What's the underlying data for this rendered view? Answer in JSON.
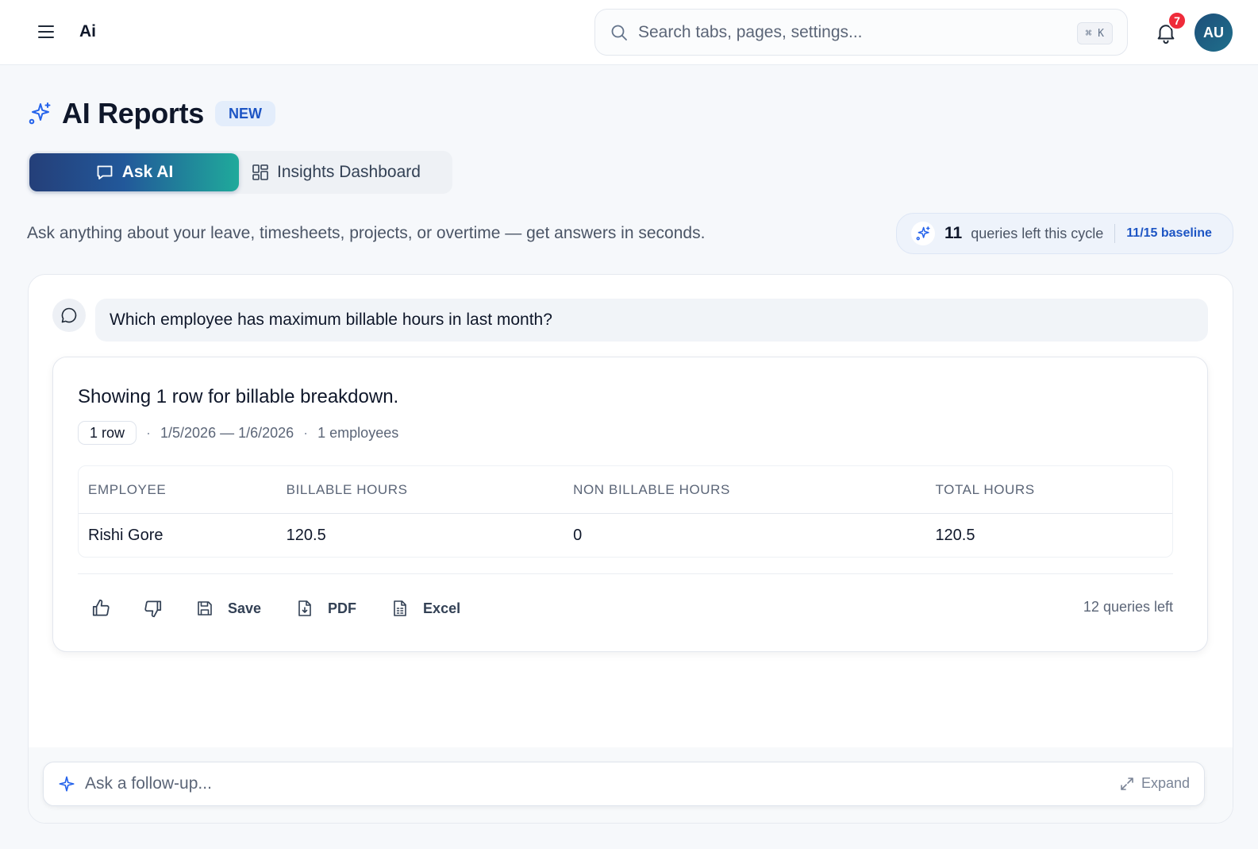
{
  "topbar": {
    "app_name": "Ai",
    "search_placeholder": "Search tabs, pages, settings...",
    "search_shortcut": "⌘ K",
    "notification_count": "7",
    "avatar_initials": "AU"
  },
  "header": {
    "title": "AI Reports",
    "badge": "NEW",
    "subtitle": "Ask anything about your leave, timesheets, projects, or overtime — get answers in seconds."
  },
  "tabs": [
    {
      "label": "Ask AI",
      "active": true
    },
    {
      "label": "Insights Dashboard",
      "active": false
    }
  ],
  "quota": {
    "count": "11",
    "label": "queries left this cycle",
    "baseline": "11/15 baseline"
  },
  "conversation": {
    "question": "Which employee has maximum billable hours in last month?",
    "answer": {
      "title": "Showing 1 row for billable breakdown.",
      "row_count": "1 row",
      "date_range": "1/5/2026 — 1/6/2026",
      "employees": "1 employees",
      "table": {
        "columns": [
          "EMPLOYEE",
          "BILLABLE HOURS",
          "NON BILLABLE HOURS",
          "TOTAL HOURS"
        ],
        "rows": [
          [
            "Rishi Gore",
            "120.5",
            "0",
            "120.5"
          ]
        ]
      },
      "actions": {
        "save": "Save",
        "pdf": "PDF",
        "excel": "Excel"
      },
      "queries_left": "12 queries left"
    }
  },
  "composer": {
    "placeholder": "Ask a follow-up...",
    "expand_label": "Expand"
  },
  "colors": {
    "accent": "#1d55c4",
    "tab_gradient_start": "#243f79",
    "tab_gradient_end": "#1faa9b",
    "badge_red": "#ef2b3a"
  }
}
